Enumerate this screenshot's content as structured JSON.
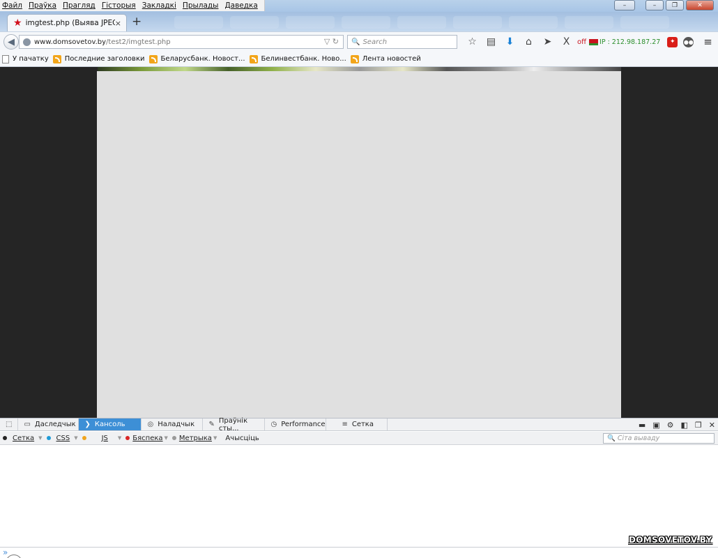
{
  "menu": {
    "items": [
      "Файл",
      "Праўка",
      "Прагляд",
      "Гісторыя",
      "Закладкі",
      "Прылады",
      "Даведка"
    ]
  },
  "window_controls": {
    "minimize": "–",
    "restore": "❐",
    "close": "✕"
  },
  "tab": {
    "title": "imgtest.php (Выява JPEG, ...",
    "close": "×",
    "new_tab": "+"
  },
  "navbar": {
    "url_host": "www.domsovetov.by",
    "url_path": "/test2/imgtest.php",
    "search_placeholder": "Search",
    "vpn_status": "off",
    "ip": "IP : 212.98.187.27"
  },
  "bookmarks": [
    {
      "label": "У пачатку",
      "icon": "page-icon"
    },
    {
      "label": "Последние заголовки",
      "icon": "rss-icon"
    },
    {
      "label": "Беларусбанк. Новост...",
      "icon": "rss-icon"
    },
    {
      "label": "Белинвестбанк. Ново...",
      "icon": "rss-icon"
    },
    {
      "label": "Лента новостей",
      "icon": "rss-icon"
    }
  ],
  "devtools": {
    "tabs": [
      {
        "label": "Даследчык",
        "icon": "inspector-icon",
        "active": false
      },
      {
        "label": "Кансоль",
        "icon": "console-icon",
        "active": true
      },
      {
        "label": "Наладчык",
        "icon": "debugger-icon",
        "active": false
      },
      {
        "label": "Праўнік сты...",
        "icon": "style-editor-icon",
        "active": false
      },
      {
        "label": "Performance",
        "icon": "performance-icon",
        "active": false
      },
      {
        "label": "Сетка",
        "icon": "network-icon",
        "active": false
      }
    ],
    "filters": [
      {
        "label": "Сетка",
        "color": "#222222"
      },
      {
        "label": "CSS",
        "color": "#1e9bd7"
      },
      {
        "label": "JS",
        "color": "#f0a41e"
      },
      {
        "label": "Бяспека",
        "color": "#d92626"
      },
      {
        "label": "Метрыка",
        "color": "#9a9a9a"
      }
    ],
    "clear_label": "Ачысціць",
    "filter_placeholder": "Сіта вываду"
  },
  "watermark": "DOMSOVETOV.BY",
  "colors": {
    "content_bg": "#252525",
    "image_bg": "#e0e0e0",
    "active_devtools_tab": "#3d8fd6"
  }
}
